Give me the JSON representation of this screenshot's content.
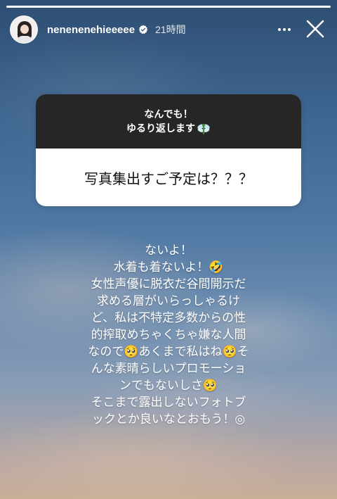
{
  "story": {
    "progress": 1.0
  },
  "header": {
    "username": "nenenenehieeeee",
    "time": "21時間"
  },
  "question_box": {
    "prompt_line1": "なんでも！",
    "prompt_line2": "ゆるり返します",
    "question": "写真集出すご予定は？？？"
  },
  "answer": {
    "lines": [
      "ないよ！",
      "水着も着ないよ！🤣",
      "女性声優に脱衣だ谷間開示だ",
      "求める層がいらっしゃるけ",
      "ど、私は不特定多数からの性",
      "的搾取めちゃくちゃ嫌な人間",
      "なので🥺あくまで私はね🥺そ",
      "んな素晴らしいプロモーショ",
      "ンでもないしさ🥺",
      "そこまで露出しないフォトブ",
      "ックとか良いなとおもう！◎"
    ]
  }
}
